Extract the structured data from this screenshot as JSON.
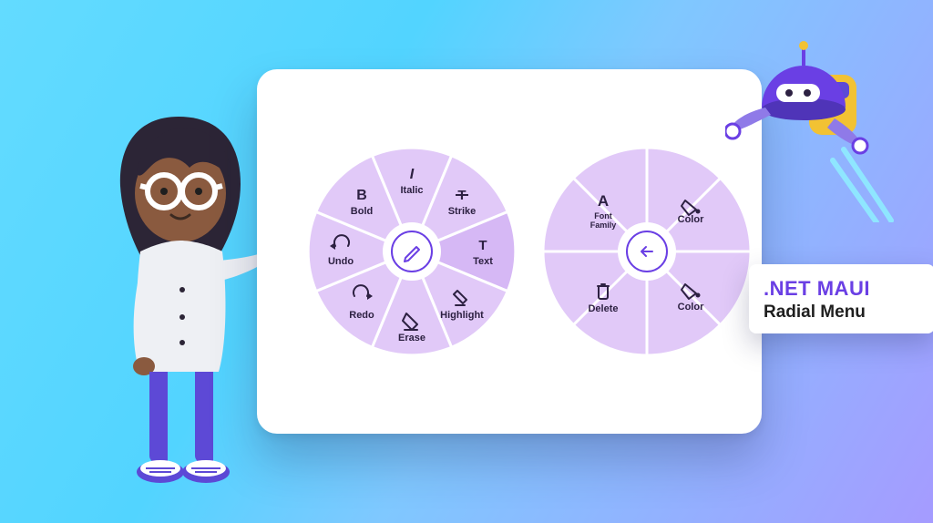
{
  "colors": {
    "accent": "#6a3fe4",
    "slice": "#e1c9f8",
    "ink": "#2d2142"
  },
  "callout": {
    "line1": ".NET MAUI",
    "line2": "Radial Menu"
  },
  "left_menu": {
    "center_icon": "pencil-icon",
    "items": [
      {
        "label": "Italic",
        "icon": "italic-icon"
      },
      {
        "label": "Strike",
        "icon": "strike-icon"
      },
      {
        "label": "Text",
        "icon": "text-icon"
      },
      {
        "label": "Highlight",
        "icon": "highlight-icon"
      },
      {
        "label": "Erase",
        "icon": "erase-icon"
      },
      {
        "label": "Redo",
        "icon": "redo-icon"
      },
      {
        "label": "Undo",
        "icon": "undo-icon"
      },
      {
        "label": "Bold",
        "icon": "bold-icon"
      }
    ]
  },
  "right_menu": {
    "center_icon": "back-arrow-icon",
    "items": [
      {
        "label": "Font Family",
        "icon": "font-icon"
      },
      {
        "label": "Color",
        "icon": "paint-bucket-icon"
      },
      {
        "label": "Color",
        "icon": "paint-bucket-icon"
      },
      {
        "label": "Delete",
        "icon": "trash-icon"
      }
    ]
  }
}
